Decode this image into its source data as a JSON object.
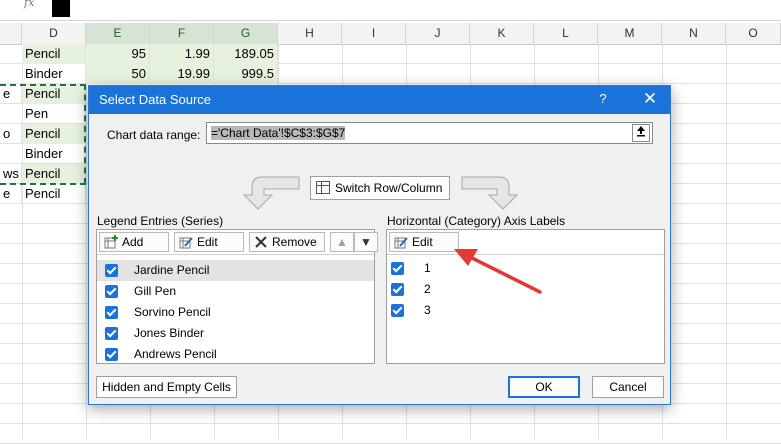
{
  "sheet": {
    "fx_label": "fx",
    "columns": [
      "D",
      "E",
      "F",
      "G",
      "H",
      "I",
      "J",
      "K",
      "L",
      "M",
      "N",
      "O"
    ],
    "left_fragments": [
      "e",
      "o",
      "ws",
      "e"
    ],
    "rows": [
      {
        "d": "Pencil",
        "e": "95",
        "f": "1.99",
        "g": "189.05"
      },
      {
        "d": "Binder",
        "e": "50",
        "f": "19.99",
        "g": "999.5"
      },
      {
        "d": "Pencil",
        "e": "",
        "f": "",
        "g": ""
      },
      {
        "d": "Pen",
        "e": "",
        "f": "",
        "g": ""
      },
      {
        "d": "Pencil",
        "e": "",
        "f": "",
        "g": ""
      },
      {
        "d": "Binder",
        "e": "",
        "f": "",
        "g": ""
      },
      {
        "d": "Pencil",
        "e": "",
        "f": "",
        "g": ""
      },
      {
        "d": "Pencil",
        "e": "",
        "f": "",
        "g": ""
      }
    ]
  },
  "dialog": {
    "title": "Select Data Source",
    "help": "?",
    "close": "✕",
    "range_label": "Chart data range:",
    "range_value": "='Chart Data'!$C$3:$G$7",
    "switch_label": "Switch Row/Column",
    "legend_label": "Legend Entries (Series)",
    "axis_label": "Horizontal (Category) Axis Labels",
    "legend_buttons": {
      "add": "Add",
      "edit": "Edit",
      "remove": "Remove",
      "up": "▲",
      "down": "▼"
    },
    "axis_edit": "Edit",
    "series": [
      "Jardine Pencil",
      "Gill Pen",
      "Sorvino Pencil",
      "Jones Binder",
      "Andrews Pencil"
    ],
    "categories": [
      "1",
      "2",
      "3"
    ],
    "hidden_cells": "Hidden and Empty Cells",
    "ok": "OK",
    "cancel": "Cancel"
  },
  "colors": {
    "accent": "#1a73d9",
    "excel_green": "#217346",
    "arrow": "#e53935"
  }
}
